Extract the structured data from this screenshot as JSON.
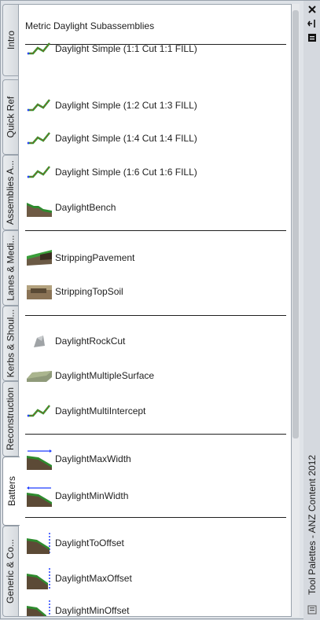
{
  "palette_title": "Metric Daylight Subassemblies",
  "window_title": "Tool Palettes - ANZ Content 2012",
  "tabs": [
    {
      "label": "Intro"
    },
    {
      "label": "Quick Ref"
    },
    {
      "label": "Assemblies A..."
    },
    {
      "label": "Lanes & Medi..."
    },
    {
      "label": "Kerbs & Shoul..."
    },
    {
      "label": "Reconstruction"
    },
    {
      "label": "Batters"
    },
    {
      "label": "Generic & Co..."
    }
  ],
  "active_tab": "Batters",
  "tools": [
    {
      "label": "Daylight Simple (1:1 Cut 1:1 FILL)",
      "icon": "daylight-simple-icon"
    },
    {
      "label": "Daylight Simple (1:2 Cut 1:3 FILL)",
      "icon": "daylight-simple-icon"
    },
    {
      "label": "Daylight Simple (1:4 Cut 1:4 FILL)",
      "icon": "daylight-simple-icon"
    },
    {
      "label": "Daylight Simple (1:6 Cut 1:6 FILL)",
      "icon": "daylight-simple-icon"
    },
    {
      "label": "DaylightBench",
      "icon": "daylight-bench-icon"
    },
    {
      "label": "StrippingPavement",
      "icon": "stripping-pavement-icon"
    },
    {
      "label": "StrippingTopSoil",
      "icon": "stripping-topsoil-icon"
    },
    {
      "label": "DaylightRockCut",
      "icon": "rock-cut-icon"
    },
    {
      "label": "DaylightMultipleSurface",
      "icon": "multiple-surface-icon"
    },
    {
      "label": "DaylightMultiIntercept",
      "icon": "daylight-simple-icon"
    },
    {
      "label": "DaylightMaxWidth",
      "icon": "max-width-icon"
    },
    {
      "label": "DaylightMinWidth",
      "icon": "min-width-icon"
    },
    {
      "label": "DaylightToOffset",
      "icon": "to-offset-icon"
    },
    {
      "label": "DaylightMaxOffset",
      "icon": "max-offset-icon"
    },
    {
      "label": "DaylightMinOffset",
      "icon": "min-offset-icon"
    }
  ],
  "titlebar_buttons": [
    "close-icon",
    "auto-hide-icon",
    "properties-icon"
  ],
  "colors": {
    "accent_green": "#2e8b2e",
    "earth_brown": "#7a5a3a",
    "dim_blue": "#1e3cff"
  }
}
